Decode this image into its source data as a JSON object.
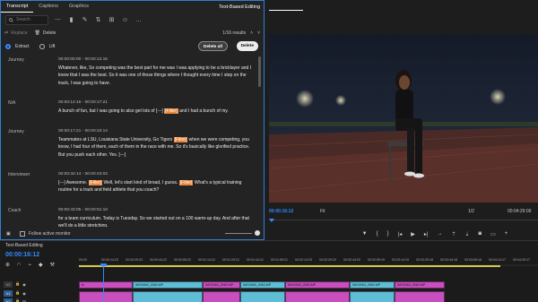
{
  "transcript_panel": {
    "tabs": [
      "Transcript",
      "Captions",
      "Graphics"
    ],
    "panel_title": "Text-Based Editing",
    "search_placeholder": "Search",
    "replace_label": "Replace",
    "delete_label": "Delete",
    "results": "1/16 results",
    "mode": {
      "extract": "Extract",
      "lift": "Lift"
    },
    "delete_all_label": "Delete all",
    "delete_button_label": "Delete",
    "follow_monitor_label": "Follow active monitor",
    "rows": [
      {
        "speaker": "Journey",
        "timecode": "00:00:00:00 - 00:00:12:16",
        "text_before": "Whatever, like, So competing was the best part for me was I was applying to be a bricklayer and I knew that I was the best. So it was one of those things where I thought every time I step on the track, I was going to have.",
        "highlight": "",
        "text_after": ""
      },
      {
        "speaker": "N/A",
        "timecode": "00:00:12:16 - 00:00:17:21",
        "text_before": "A bunch of fun, but I was going to also get lots of [---]",
        "highlight": "[Filler]",
        "text_after": "and I had a bunch of my."
      },
      {
        "speaker": "Journey",
        "timecode": "00:00:17:21 - 00:00:34:14",
        "text_before": "Teammates at LSU, Louisiana State University, Go Tigers",
        "highlight": "[Filler]",
        "text_after": "when we were competing, you know, I had four of them, each of them in the race with me. So it's basically like glorified practice. But you push each other. Yes. [---]"
      },
      {
        "speaker": "Interviewer",
        "timecode": "00:00:34:14 - 00:00:43:03",
        "text_before": "[---] Awesome.",
        "highlight": "[Filler]",
        "text_after": "Well, let's start kind of broad, I guess.",
        "highlight2": "[Filler]",
        "text_after2": "What's a typical training routine for a track and field athlete that you coach?"
      },
      {
        "speaker": "Coach",
        "timecode": "00:00:43:05 - 00:00:51:10",
        "text_before": "for a team curriculum. Today is Tuesday. So we started out on a 100 warm-up day. And after that we'll do a little stretching.",
        "highlight": "",
        "text_after": ""
      }
    ]
  },
  "program_monitor": {
    "current_time": "00:00:16:12",
    "fit": "Fit",
    "scale": "1/2",
    "duration": "00:04:29:09",
    "controls": [
      "mark-in-icon",
      "mark-out-icon",
      "go-to-in-icon",
      "step-back-icon",
      "play-icon",
      "step-forward-icon",
      "go-to-out-icon",
      "lift-icon",
      "extract-icon",
      "export-frame-icon",
      "comparison-icon",
      "settings-icon"
    ]
  },
  "timeline": {
    "title": "Text-Based Editing",
    "current_time": "00:00:16:12",
    "ruler": [
      "00:00",
      "00:00:14:23",
      "00:00:29:23",
      "00:00:44:22",
      "00:00:59:22",
      "00:01:14:22",
      "00:01:29:21",
      "00:01:44:21",
      "00:01:59:21",
      "00:02:14:20",
      "00:02:29:20",
      "00:02:44:20",
      "00:02:59:19",
      "00:03:14:19",
      "00:03:29:18",
      "00:03:44:18",
      "00:03:59:18",
      "00:04:14:17",
      "00:04:29:17"
    ],
    "tracks": [
      {
        "name": "V2",
        "type": "video"
      },
      {
        "name": "V1",
        "type": "video"
      },
      {
        "name": "A1",
        "type": "audio"
      }
    ],
    "clips": [
      {
        "label": "fx",
        "kind": "v"
      },
      {
        "label": "IMG0063_0063.MP",
        "kind": "v2"
      },
      {
        "label": "IMG0063_0063.MP",
        "kind": "v"
      },
      {
        "label": "IMG0063_0063.MP",
        "kind": "v2"
      },
      {
        "label": "IMG0063_0063.MP",
        "kind": "v"
      },
      {
        "label": "IMG0063_0063.MP",
        "kind": "v2"
      },
      {
        "label": "IMG0063_0063.MP",
        "kind": "v"
      }
    ]
  },
  "colors": {
    "accent": "#2f8cff",
    "panel_border": "#2f7fd8",
    "highlight": "#e8843c",
    "clip_magenta": "#c84fbd",
    "clip_cyan": "#5fbed6",
    "workbar": "#d7c64a"
  }
}
